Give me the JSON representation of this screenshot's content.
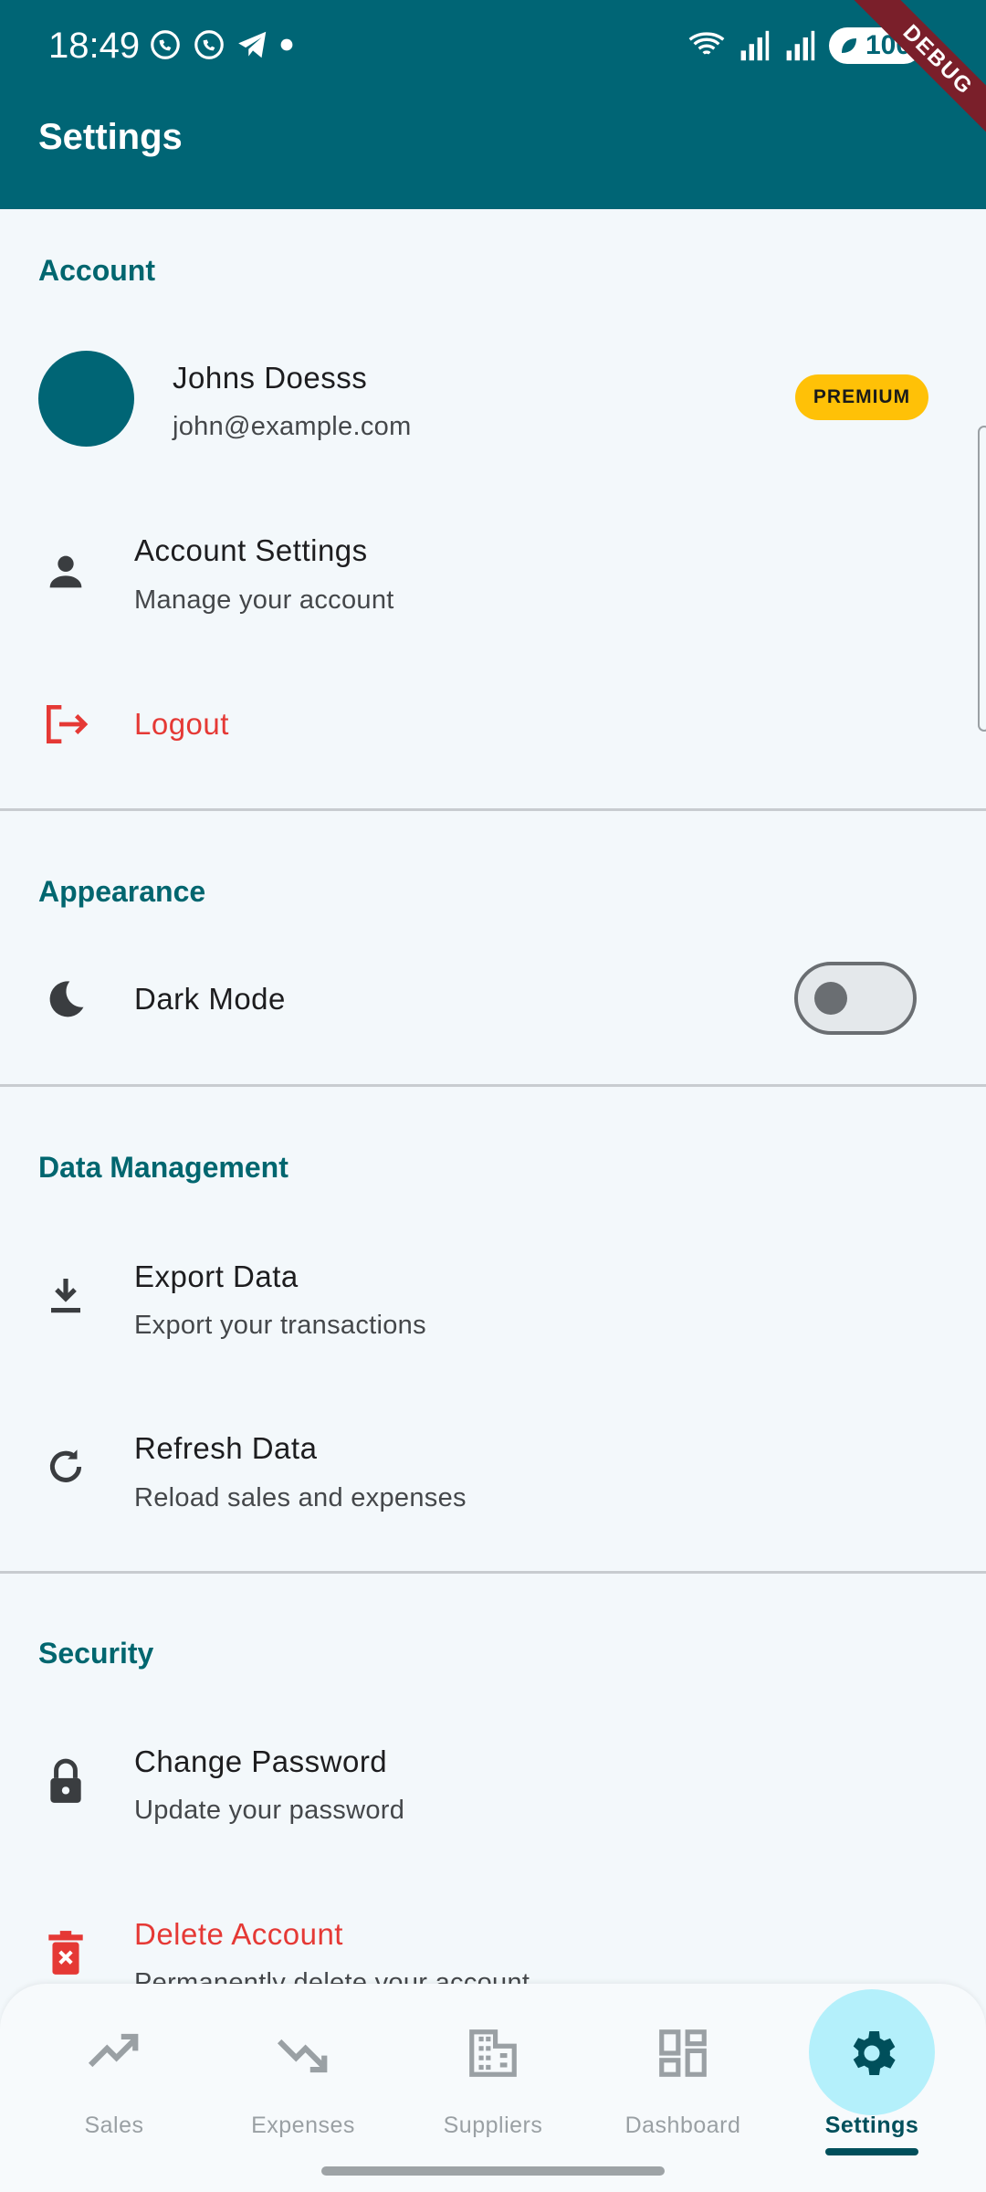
{
  "status_bar": {
    "time": "18:49",
    "battery": "100",
    "debug_label": "DEBUG"
  },
  "app_bar": {
    "title": "Settings"
  },
  "sections": {
    "account": {
      "title": "Account",
      "user_name": "Johns Doesss",
      "user_email": "john@example.com",
      "badge": "PREMIUM",
      "settings_title": "Account Settings",
      "settings_sub": "Manage your account",
      "logout": "Logout"
    },
    "appearance": {
      "title": "Appearance",
      "dark_mode": "Dark Mode",
      "dark_mode_enabled": false
    },
    "data": {
      "title": "Data Management",
      "export_title": "Export Data",
      "export_sub": "Export your transactions",
      "refresh_title": "Refresh Data",
      "refresh_sub": "Reload sales and expenses"
    },
    "security": {
      "title": "Security",
      "change_pw_title": "Change Password",
      "change_pw_sub": "Update your password",
      "delete_title": "Delete Account",
      "delete_sub": "Permanently delete your account"
    }
  },
  "bottom_nav": {
    "items": [
      {
        "label": "Sales",
        "icon": "trending-up-icon"
      },
      {
        "label": "Expenses",
        "icon": "trending-down-icon"
      },
      {
        "label": "Suppliers",
        "icon": "building-icon"
      },
      {
        "label": "Dashboard",
        "icon": "dashboard-icon"
      },
      {
        "label": "Settings",
        "icon": "gear-icon",
        "active": true
      }
    ]
  },
  "colors": {
    "primary": "#006575",
    "danger": "#e53935",
    "badge": "#ffc107",
    "background": "#f3f8fb"
  }
}
